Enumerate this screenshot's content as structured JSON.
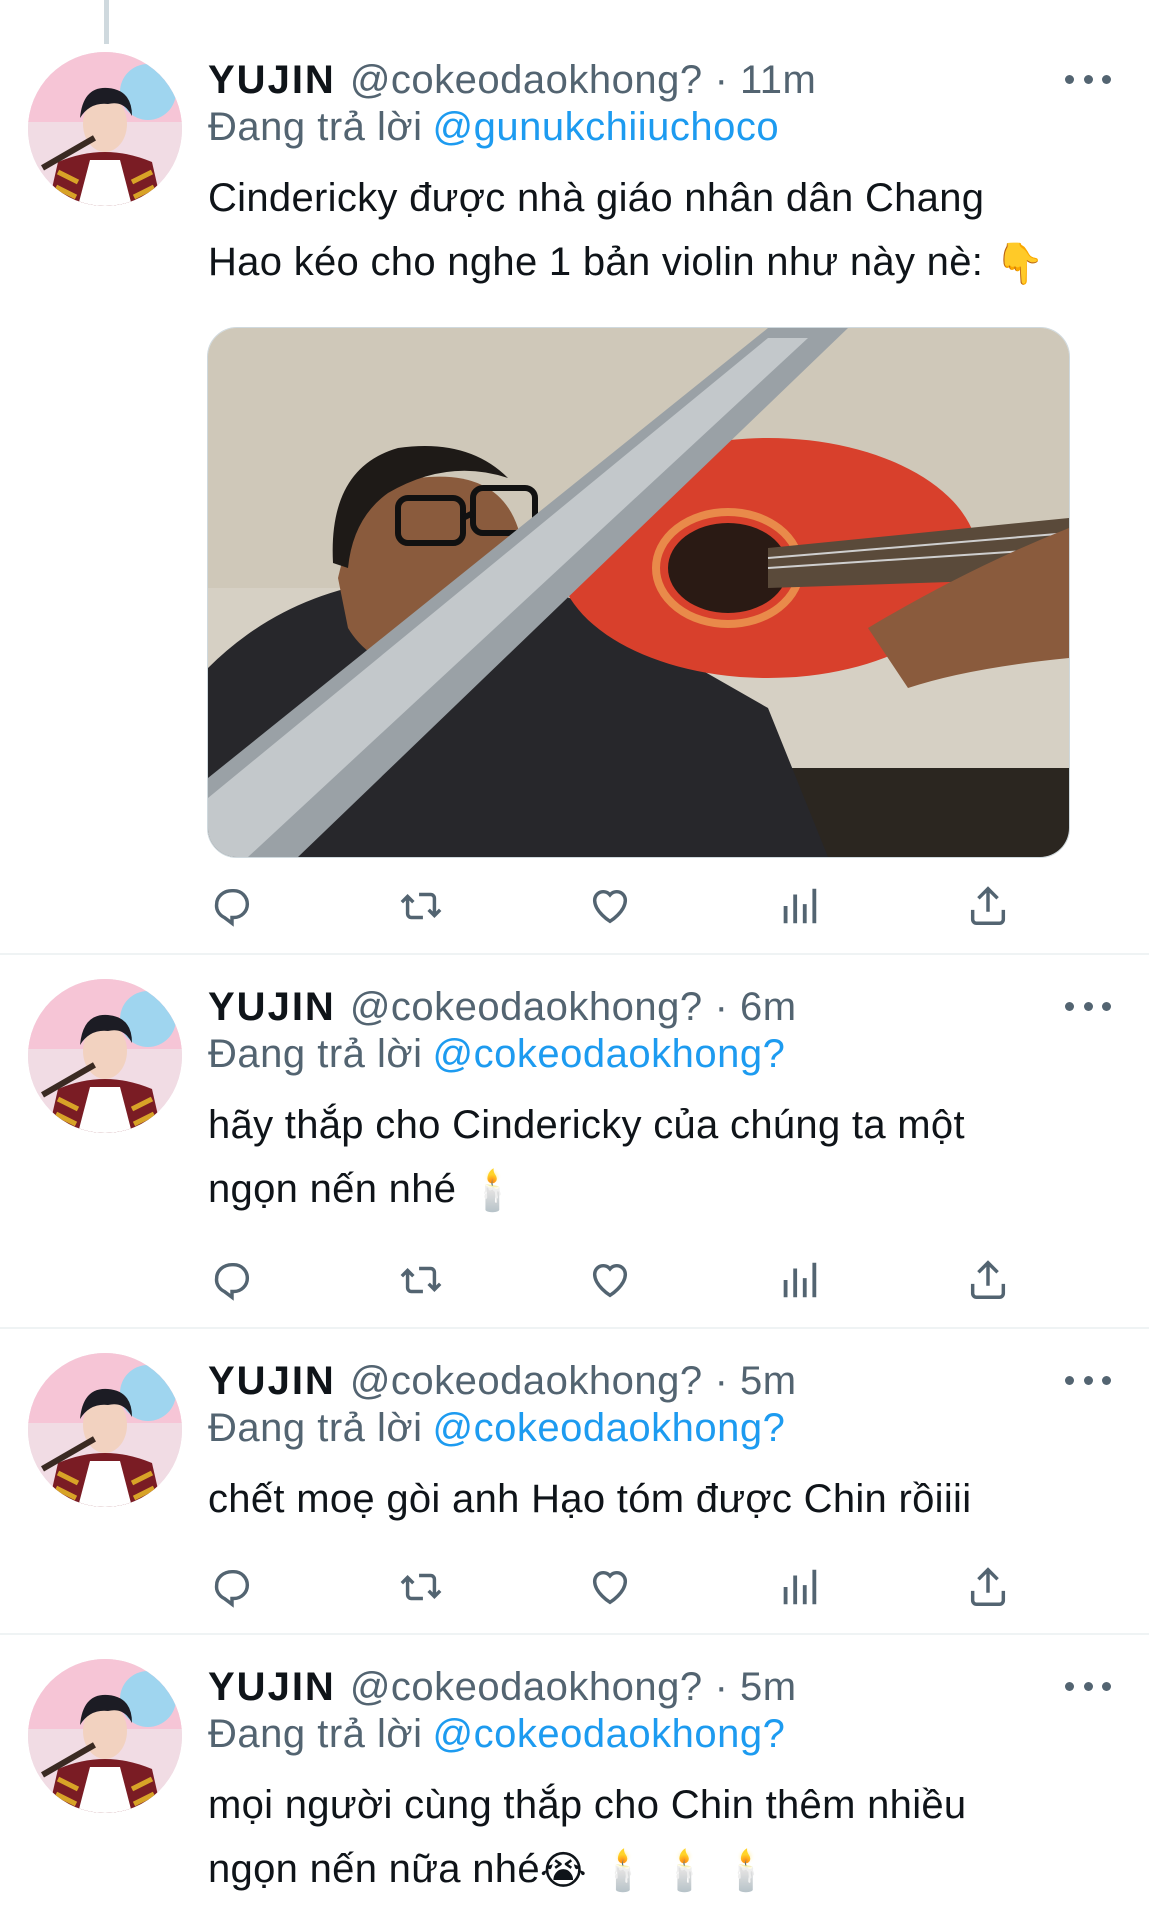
{
  "tweets": [
    {
      "name": "YUJIN",
      "handle": "@cokeodaokhong?",
      "sep": "·",
      "time": "11m",
      "reply_prefix": "Đang trả lời",
      "reply_to": "@gunukchiiuchoco",
      "text_line1": "Cindericky được nhà giáo nhân dân Chang",
      "text_line2": "Hao kéo cho nghe 1 bản violin như này nè:",
      "emoji": "👇",
      "media": "photo-man-guitar-saw"
    },
    {
      "name": "YUJIN",
      "handle": "@cokeodaokhong?",
      "sep": "·",
      "time": "6m",
      "reply_prefix": "Đang trả lời",
      "reply_to": "@cokeodaokhong?",
      "text_line1": "hãy thắp cho Cindericky của chúng ta một",
      "text_line2": "ngọn nến nhé",
      "emoji": "🕯️"
    },
    {
      "name": "YUJIN",
      "handle": "@cokeodaokhong?",
      "sep": "·",
      "time": "5m",
      "reply_prefix": "Đang trả lời",
      "reply_to": "@cokeodaokhong?",
      "text_line1": "chết moẹ gòi anh Hạo tóm được Chin rồiiii"
    },
    {
      "name": "YUJIN",
      "handle": "@cokeodaokhong?",
      "sep": "·",
      "time": "5m",
      "reply_prefix": "Đang trả lời",
      "reply_to": "@cokeodaokhong?",
      "text_line1": "mọi người cùng thắp cho Chin thêm nhiều",
      "text_line2": "ngọn nến nữa nhé",
      "emoji": "😭 🕯️ 🕯️ 🕯️"
    }
  ],
  "icons": {
    "reply": "reply-icon",
    "retweet": "retweet-icon",
    "like": "heart-icon",
    "views": "views-icon",
    "share": "share-icon",
    "more": "more-icon"
  },
  "colors": {
    "link": "#1d9bf0",
    "secondary": "#536471",
    "divider": "#eff3f4"
  }
}
